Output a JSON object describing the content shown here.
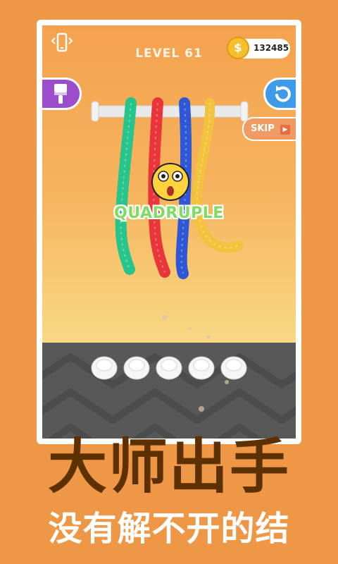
{
  "hud": {
    "level_label": "LEVEL 61",
    "coin_symbol": "$",
    "coin_count": "132485",
    "skip_label": "SKIP",
    "skip_ad_symbol": "▶"
  },
  "icons": {
    "left_top": "phone-vibrate-icon",
    "left_button": "paint-brush-icon",
    "right_button": "restart-arrow-icon",
    "coin": "coin-icon",
    "emoji": "shocked-face-icon"
  },
  "game": {
    "combo_text": "QUADRUPLE",
    "rope_colors": [
      "#27c48c",
      "#e8363b",
      "#2e58d6",
      "#f2c23c"
    ],
    "rack_pegs": 5,
    "accent": "#ee9747"
  },
  "banner": {
    "title": "大师出手",
    "subtitle": "没有解不开的结"
  }
}
